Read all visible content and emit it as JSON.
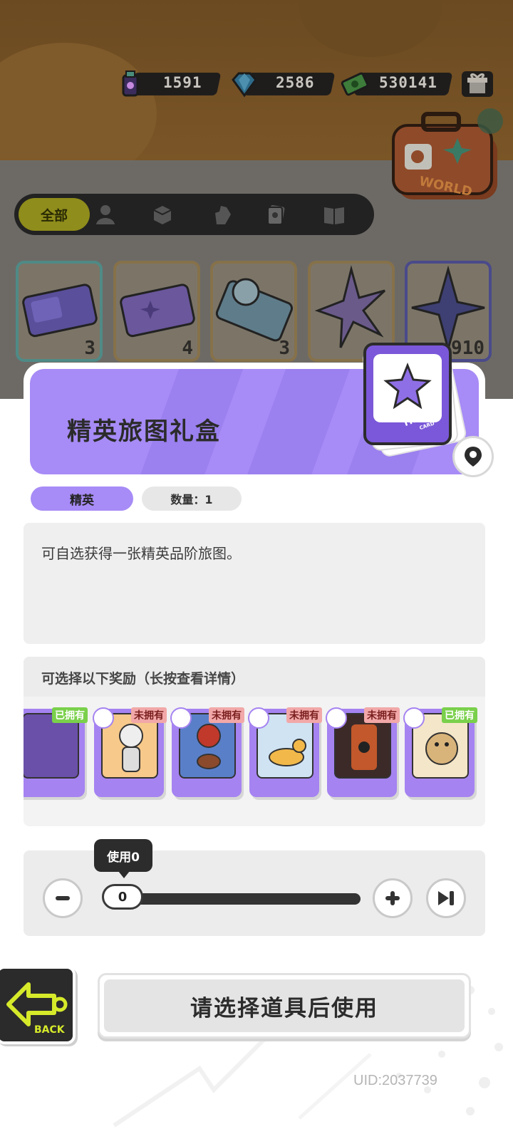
{
  "currencies": [
    {
      "icon": "spray-can-icon",
      "value": "1591"
    },
    {
      "icon": "diamond-icon",
      "value": "2586"
    },
    {
      "icon": "cash-icon",
      "value": "530141"
    }
  ],
  "gift_icon": "gift-box-icon",
  "suitcase_label": "WORLD",
  "filters": {
    "active_label": "全部",
    "icons": [
      "person-icon",
      "box-icon",
      "hand-icon",
      "photo-card-icon",
      "book-icon"
    ]
  },
  "inventory": [
    {
      "count": "3"
    },
    {
      "count": "4"
    },
    {
      "count": "3"
    },
    {
      "count": ""
    },
    {
      "count": "910"
    }
  ],
  "item": {
    "title": "精英旅图礼盒",
    "card_text": "TRAVEL",
    "card_sub": "CARD",
    "rank": "精英",
    "quantity_label": "数量：1",
    "description": "可自选获得一张精英品阶旅图。"
  },
  "rewards": {
    "title": "可选择以下奖励（长按查看详情）",
    "cards": [
      {
        "status": "已拥有",
        "owned": true
      },
      {
        "status": "未拥有",
        "owned": false
      },
      {
        "status": "未拥有",
        "owned": false
      },
      {
        "status": "未拥有",
        "owned": false
      },
      {
        "status": "未拥有",
        "owned": false
      },
      {
        "status": "已拥有",
        "owned": true
      }
    ]
  },
  "usage": {
    "tooltip": "使用0",
    "value": "0"
  },
  "buttons": {
    "back_label": "BACK",
    "confirm_label": "请选择道具后使用"
  },
  "uid": "UID:2037739",
  "colors": {
    "accent_purple": "#a78bf6",
    "owned_green": "#7ad04b",
    "unowned_pink": "#f2a8a8"
  }
}
